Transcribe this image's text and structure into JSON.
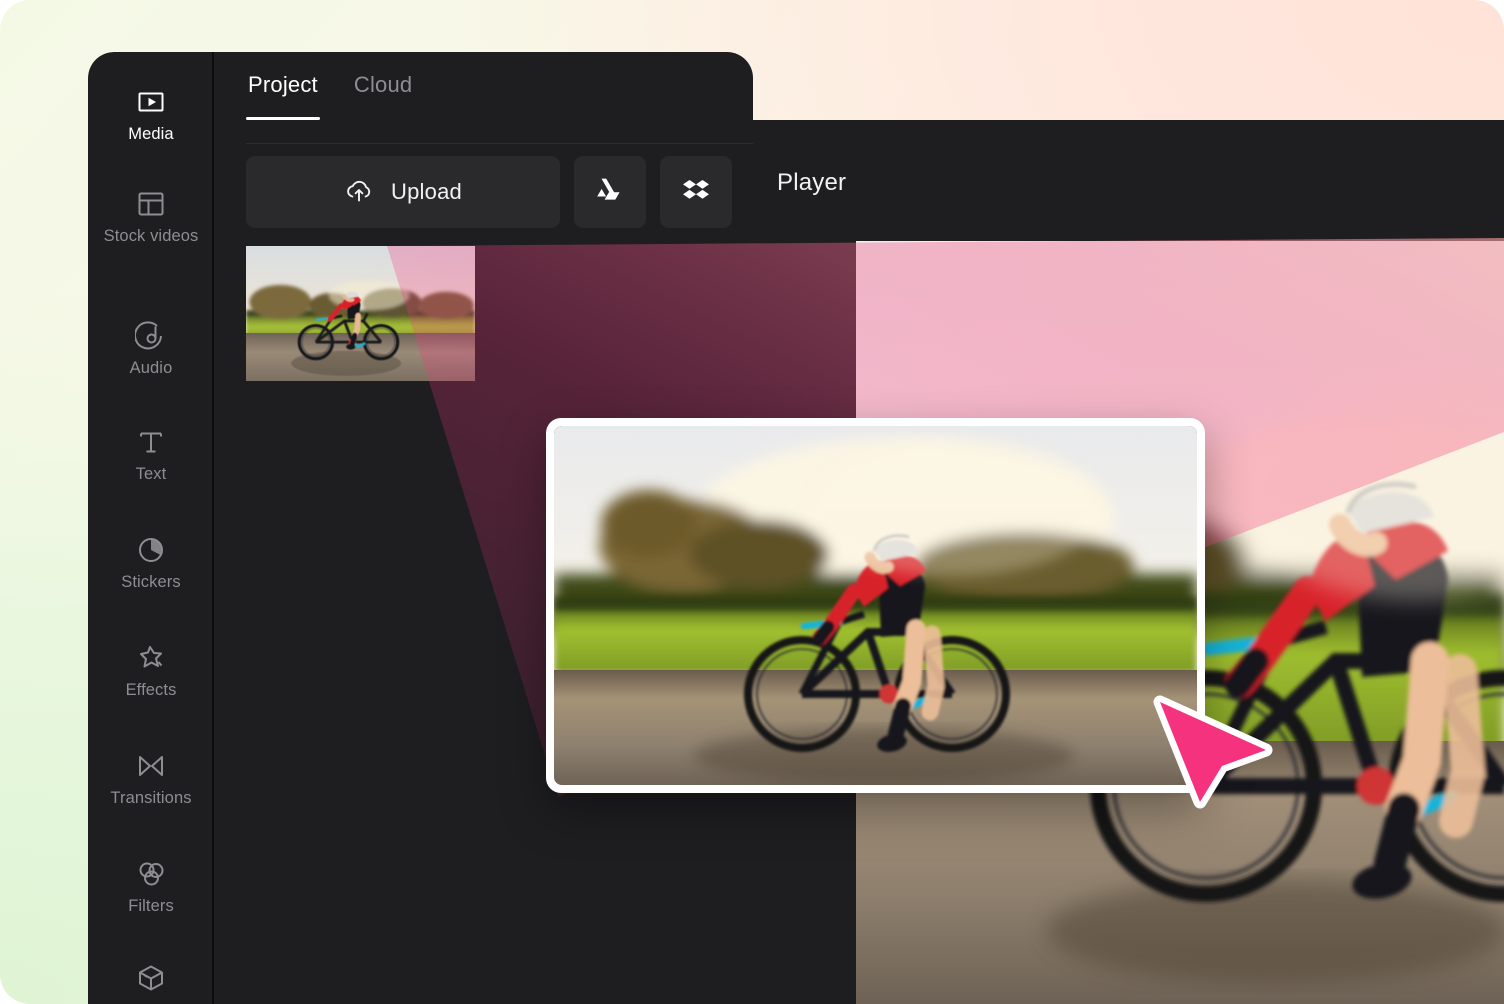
{
  "app": {
    "name": "video-editor",
    "background_colors": [
      "#f4f9e6",
      "#fdf6ea",
      "#fde7e0"
    ],
    "panel_bg": "#1e1e20",
    "accent": "#f5327e"
  },
  "sidebar": {
    "items": [
      {
        "label": "Media",
        "icon": "media-play-icon",
        "active": true
      },
      {
        "label": "Stock videos",
        "icon": "layout-grid-icon",
        "active": false
      },
      {
        "label": "Audio",
        "icon": "audio-note-icon",
        "active": false
      },
      {
        "label": "Text",
        "icon": "text-t-icon",
        "active": false
      },
      {
        "label": "Stickers",
        "icon": "sticker-circle-icon",
        "active": false
      },
      {
        "label": "Effects",
        "icon": "effects-star-icon",
        "active": false
      },
      {
        "label": "Transitions",
        "icon": "transitions-bowtie-icon",
        "active": false
      },
      {
        "label": "Filters",
        "icon": "filters-rings-icon",
        "active": false
      },
      {
        "label": "",
        "icon": "cube-3d-icon",
        "active": false
      }
    ]
  },
  "media_panel": {
    "tabs": [
      {
        "label": "Project",
        "active": true
      },
      {
        "label": "Cloud",
        "active": false
      }
    ],
    "upload": {
      "label": "Upload",
      "icon": "cloud-upload-icon"
    },
    "cloud_buttons": [
      {
        "name": "google-drive-button",
        "icon": "google-drive-icon"
      },
      {
        "name": "dropbox-button",
        "icon": "dropbox-icon"
      }
    ],
    "media_items": [
      {
        "name": "cyclist-clip",
        "alt": "Cyclist riding a road bike at sunset"
      }
    ]
  },
  "player": {
    "title": "Player",
    "content_alt": "Cyclist riding a road bike at sunset"
  },
  "drag": {
    "card_alt": "Cyclist riding a road bike at sunset",
    "cursor": {
      "name": "pointer-cursor",
      "color": "#f5327e",
      "outline": "#ffffff"
    },
    "trail_color": "#f5a0a4"
  }
}
